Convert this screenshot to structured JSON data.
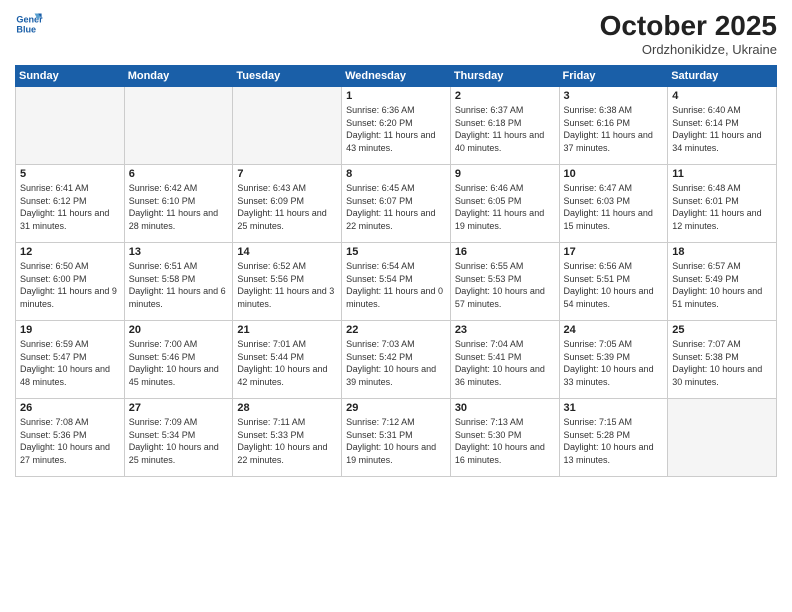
{
  "logo": {
    "line1": "General",
    "line2": "Blue"
  },
  "title": "October 2025",
  "location": "Ordzhonikidze, Ukraine",
  "weekdays": [
    "Sunday",
    "Monday",
    "Tuesday",
    "Wednesday",
    "Thursday",
    "Friday",
    "Saturday"
  ],
  "weeks": [
    [
      {
        "day": "",
        "sunrise": "",
        "sunset": "",
        "daylight": ""
      },
      {
        "day": "",
        "sunrise": "",
        "sunset": "",
        "daylight": ""
      },
      {
        "day": "",
        "sunrise": "",
        "sunset": "",
        "daylight": ""
      },
      {
        "day": "1",
        "sunrise": "Sunrise: 6:36 AM",
        "sunset": "Sunset: 6:20 PM",
        "daylight": "Daylight: 11 hours and 43 minutes."
      },
      {
        "day": "2",
        "sunrise": "Sunrise: 6:37 AM",
        "sunset": "Sunset: 6:18 PM",
        "daylight": "Daylight: 11 hours and 40 minutes."
      },
      {
        "day": "3",
        "sunrise": "Sunrise: 6:38 AM",
        "sunset": "Sunset: 6:16 PM",
        "daylight": "Daylight: 11 hours and 37 minutes."
      },
      {
        "day": "4",
        "sunrise": "Sunrise: 6:40 AM",
        "sunset": "Sunset: 6:14 PM",
        "daylight": "Daylight: 11 hours and 34 minutes."
      }
    ],
    [
      {
        "day": "5",
        "sunrise": "Sunrise: 6:41 AM",
        "sunset": "Sunset: 6:12 PM",
        "daylight": "Daylight: 11 hours and 31 minutes."
      },
      {
        "day": "6",
        "sunrise": "Sunrise: 6:42 AM",
        "sunset": "Sunset: 6:10 PM",
        "daylight": "Daylight: 11 hours and 28 minutes."
      },
      {
        "day": "7",
        "sunrise": "Sunrise: 6:43 AM",
        "sunset": "Sunset: 6:09 PM",
        "daylight": "Daylight: 11 hours and 25 minutes."
      },
      {
        "day": "8",
        "sunrise": "Sunrise: 6:45 AM",
        "sunset": "Sunset: 6:07 PM",
        "daylight": "Daylight: 11 hours and 22 minutes."
      },
      {
        "day": "9",
        "sunrise": "Sunrise: 6:46 AM",
        "sunset": "Sunset: 6:05 PM",
        "daylight": "Daylight: 11 hours and 19 minutes."
      },
      {
        "day": "10",
        "sunrise": "Sunrise: 6:47 AM",
        "sunset": "Sunset: 6:03 PM",
        "daylight": "Daylight: 11 hours and 15 minutes."
      },
      {
        "day": "11",
        "sunrise": "Sunrise: 6:48 AM",
        "sunset": "Sunset: 6:01 PM",
        "daylight": "Daylight: 11 hours and 12 minutes."
      }
    ],
    [
      {
        "day": "12",
        "sunrise": "Sunrise: 6:50 AM",
        "sunset": "Sunset: 6:00 PM",
        "daylight": "Daylight: 11 hours and 9 minutes."
      },
      {
        "day": "13",
        "sunrise": "Sunrise: 6:51 AM",
        "sunset": "Sunset: 5:58 PM",
        "daylight": "Daylight: 11 hours and 6 minutes."
      },
      {
        "day": "14",
        "sunrise": "Sunrise: 6:52 AM",
        "sunset": "Sunset: 5:56 PM",
        "daylight": "Daylight: 11 hours and 3 minutes."
      },
      {
        "day": "15",
        "sunrise": "Sunrise: 6:54 AM",
        "sunset": "Sunset: 5:54 PM",
        "daylight": "Daylight: 11 hours and 0 minutes."
      },
      {
        "day": "16",
        "sunrise": "Sunrise: 6:55 AM",
        "sunset": "Sunset: 5:53 PM",
        "daylight": "Daylight: 10 hours and 57 minutes."
      },
      {
        "day": "17",
        "sunrise": "Sunrise: 6:56 AM",
        "sunset": "Sunset: 5:51 PM",
        "daylight": "Daylight: 10 hours and 54 minutes."
      },
      {
        "day": "18",
        "sunrise": "Sunrise: 6:57 AM",
        "sunset": "Sunset: 5:49 PM",
        "daylight": "Daylight: 10 hours and 51 minutes."
      }
    ],
    [
      {
        "day": "19",
        "sunrise": "Sunrise: 6:59 AM",
        "sunset": "Sunset: 5:47 PM",
        "daylight": "Daylight: 10 hours and 48 minutes."
      },
      {
        "day": "20",
        "sunrise": "Sunrise: 7:00 AM",
        "sunset": "Sunset: 5:46 PM",
        "daylight": "Daylight: 10 hours and 45 minutes."
      },
      {
        "day": "21",
        "sunrise": "Sunrise: 7:01 AM",
        "sunset": "Sunset: 5:44 PM",
        "daylight": "Daylight: 10 hours and 42 minutes."
      },
      {
        "day": "22",
        "sunrise": "Sunrise: 7:03 AM",
        "sunset": "Sunset: 5:42 PM",
        "daylight": "Daylight: 10 hours and 39 minutes."
      },
      {
        "day": "23",
        "sunrise": "Sunrise: 7:04 AM",
        "sunset": "Sunset: 5:41 PM",
        "daylight": "Daylight: 10 hours and 36 minutes."
      },
      {
        "day": "24",
        "sunrise": "Sunrise: 7:05 AM",
        "sunset": "Sunset: 5:39 PM",
        "daylight": "Daylight: 10 hours and 33 minutes."
      },
      {
        "day": "25",
        "sunrise": "Sunrise: 7:07 AM",
        "sunset": "Sunset: 5:38 PM",
        "daylight": "Daylight: 10 hours and 30 minutes."
      }
    ],
    [
      {
        "day": "26",
        "sunrise": "Sunrise: 7:08 AM",
        "sunset": "Sunset: 5:36 PM",
        "daylight": "Daylight: 10 hours and 27 minutes."
      },
      {
        "day": "27",
        "sunrise": "Sunrise: 7:09 AM",
        "sunset": "Sunset: 5:34 PM",
        "daylight": "Daylight: 10 hours and 25 minutes."
      },
      {
        "day": "28",
        "sunrise": "Sunrise: 7:11 AM",
        "sunset": "Sunset: 5:33 PM",
        "daylight": "Daylight: 10 hours and 22 minutes."
      },
      {
        "day": "29",
        "sunrise": "Sunrise: 7:12 AM",
        "sunset": "Sunset: 5:31 PM",
        "daylight": "Daylight: 10 hours and 19 minutes."
      },
      {
        "day": "30",
        "sunrise": "Sunrise: 7:13 AM",
        "sunset": "Sunset: 5:30 PM",
        "daylight": "Daylight: 10 hours and 16 minutes."
      },
      {
        "day": "31",
        "sunrise": "Sunrise: 7:15 AM",
        "sunset": "Sunset: 5:28 PM",
        "daylight": "Daylight: 10 hours and 13 minutes."
      },
      {
        "day": "",
        "sunrise": "",
        "sunset": "",
        "daylight": ""
      }
    ]
  ]
}
